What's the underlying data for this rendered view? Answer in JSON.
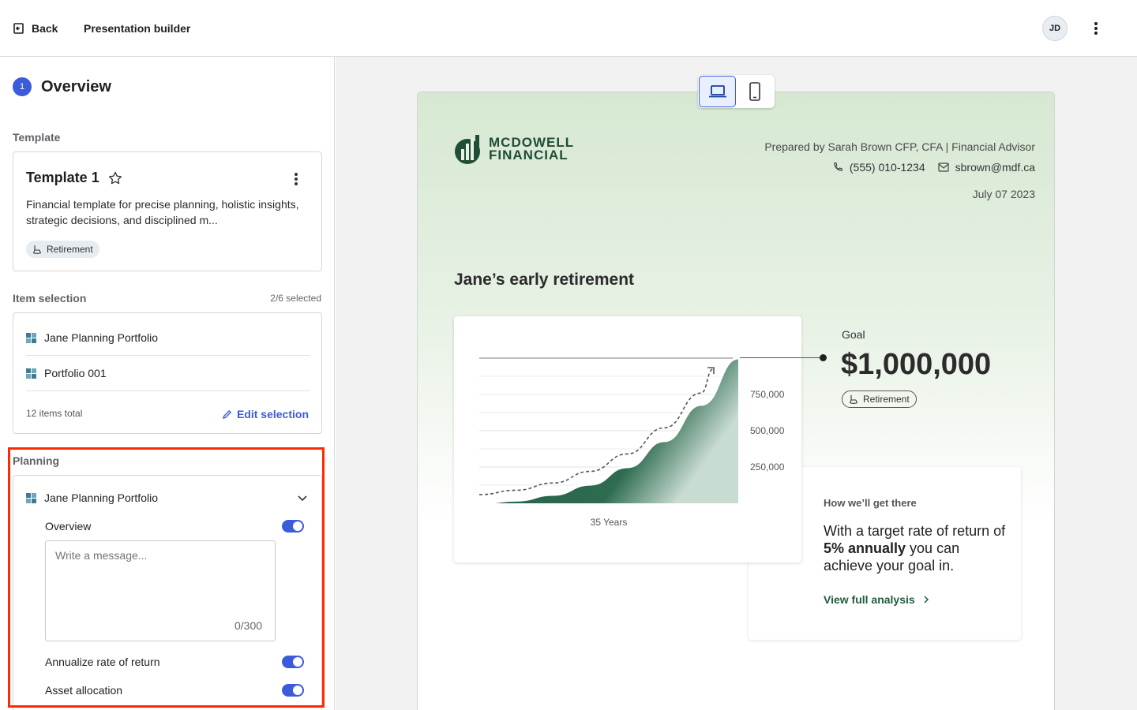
{
  "topbar": {
    "back_label": "Back",
    "title": "Presentation builder",
    "avatar_initials": "JD"
  },
  "left": {
    "step_number": "1",
    "step_title": "Overview",
    "template_section": "Template",
    "template": {
      "name": "Template 1",
      "description": "Financial template for precise planning, holistic insights, strategic decisions, and disciplined m...",
      "tag": "Retirement"
    },
    "item_selection": {
      "label": "Item selection",
      "count": "2/6 selected",
      "items": [
        "Jane Planning Portfolio",
        "Portfolio 001"
      ],
      "total": "12 items total",
      "edit_label": "Edit selection"
    },
    "planning": {
      "label": "Planning",
      "portfolio": "Jane Planning Portfolio",
      "overview_label": "Overview",
      "overview_on": true,
      "message_placeholder": "Write a message...",
      "message_counter": "0/300",
      "annualize_label": "Annualize rate of return",
      "annualize_on": true,
      "asset_label": "Asset allocation",
      "asset_on": true
    }
  },
  "preview": {
    "logo_line1": "MCDOWELL",
    "logo_line2": "FINANCIAL",
    "prepared_by": "Prepared by Sarah Brown  CFP, CFA  |  Financial Advisor",
    "phone": "(555) 010-1234",
    "email": "sbrown@mdf.ca",
    "date": "July 07 2023",
    "plan_title": "Jane’s early retirement",
    "goal_label": "Goal",
    "goal_value": "$1,000,000",
    "goal_tag": "Retirement",
    "how_label": "How we’ll get there",
    "how_text_1": "With a target rate of return of ",
    "how_text_bold": "5% annually",
    "how_text_2": " you can achieve your goal in.",
    "how_link": "View full analysis"
  },
  "chart_data": {
    "type": "area",
    "xlabel": "35 Years",
    "y_ticks": [
      "750,000",
      "500,000",
      "250,000"
    ],
    "ylim": [
      0,
      1000000
    ],
    "series": [
      {
        "values": [
          0,
          20000,
          60000,
          130000,
          250000,
          430000,
          680000,
          1000000
        ]
      },
      {
        "values": [
          60000,
          90000,
          140000,
          220000,
          340000,
          520000,
          760000,
          1000000
        ]
      }
    ]
  },
  "colors": {
    "accent": "#3b5bdb",
    "brand_green": "#1f4d35",
    "highlight": "#ff2a00"
  }
}
